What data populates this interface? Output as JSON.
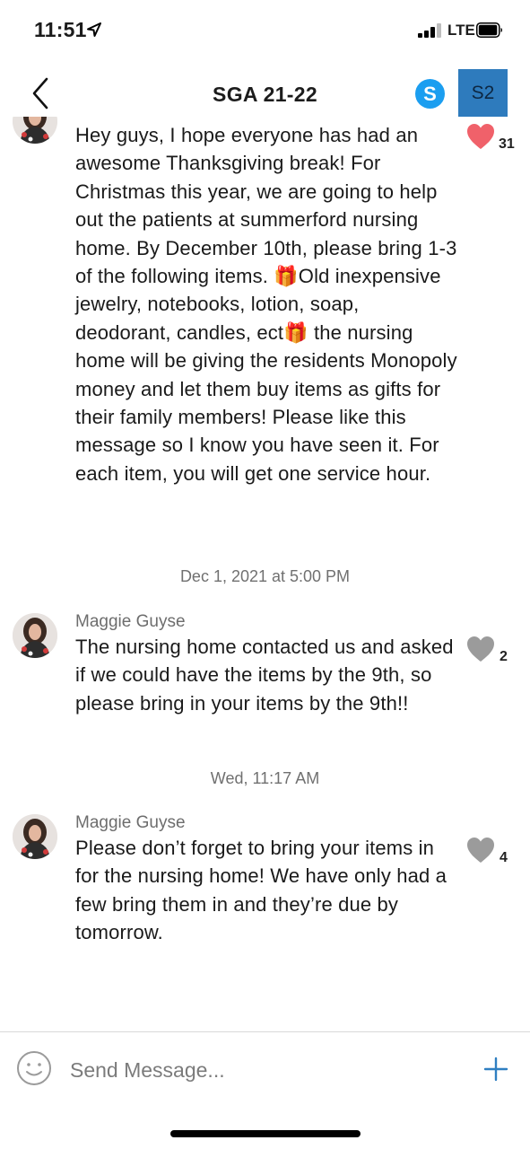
{
  "status_bar": {
    "time": "11:51",
    "network": "LTE"
  },
  "header": {
    "title": "SGA 21-22",
    "skype_glyph": "S",
    "group_avatar_initials": "S2",
    "back_icon": "chevron-left-icon"
  },
  "messages": [
    {
      "sender": "",
      "text": "Hey guys, I hope everyone has had an awesome Thanksgiving break! For Christmas this year, we are going to help out the patients at summerford nursing home. By December 10th, please bring 1-3 of the following items. 🎁Old inexpensive jewelry, notebooks, lotion, soap, deodorant, candles, ect🎁 the nursing home will be giving the residents Monopoly money and let them buy items as gifts for their family members! Please like this message so I know you have seen it. For each item, you will get one service hour.",
      "likes": "31",
      "liked": true
    },
    {
      "sender": "Maggie Guyse",
      "text": "The nursing home contacted us and asked if we could have the items by the 9th, so please bring in your items by the 9th!!",
      "likes": "2",
      "liked": false
    },
    {
      "sender": "Maggie Guyse",
      "text": "Please don’t forget to bring your items in for the nursing home! We have only had a few bring them in and they’re due by tomorrow.",
      "likes": "4",
      "liked": false
    }
  ],
  "timestamps": [
    "Dec 1, 2021 at 5:00 PM",
    "Wed, 11:17 AM"
  ],
  "composer": {
    "placeholder": "Send Message..."
  },
  "colors": {
    "liked_heart": "#f0616a",
    "unliked_heart": "#9b9b9b",
    "skype_blue": "#1b9ef0",
    "group_avatar": "#2e7bbd",
    "accent_plus": "#2f7fc1"
  }
}
